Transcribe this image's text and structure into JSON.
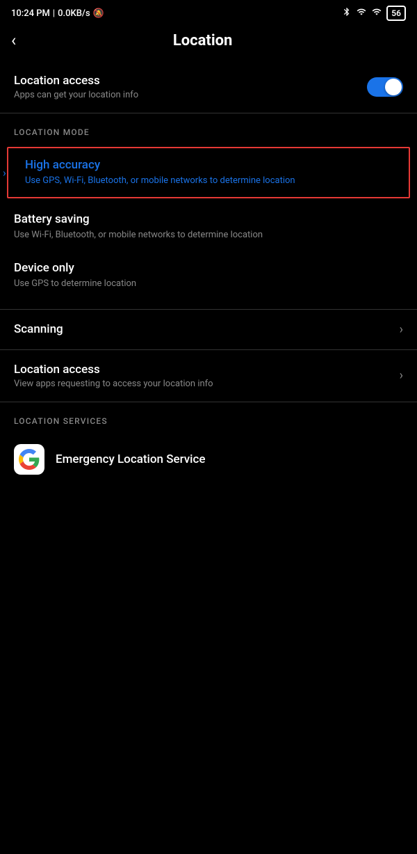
{
  "statusBar": {
    "time": "10:24 PM",
    "network": "0.0KB/s",
    "battery": "56"
  },
  "header": {
    "backLabel": "‹",
    "title": "Location"
  },
  "locationAccess": {
    "title": "Location access",
    "subtitle": "Apps can get your location info",
    "toggleOn": true
  },
  "locationMode": {
    "sectionLabel": "LOCATION MODE",
    "modes": [
      {
        "title": "High accuracy",
        "desc": "Use GPS, Wi-Fi, Bluetooth, or mobile networks to determine location",
        "highlighted": true,
        "showChevron": true
      },
      {
        "title": "Battery saving",
        "desc": "Use Wi-Fi, Bluetooth, or mobile networks to determine location",
        "highlighted": false,
        "showChevron": false
      },
      {
        "title": "Device only",
        "desc": "Use GPS to determine location",
        "highlighted": false,
        "showChevron": false
      }
    ]
  },
  "navItems": [
    {
      "title": "Scanning",
      "desc": "",
      "showChevron": true
    },
    {
      "title": "Location access",
      "desc": "View apps requesting to access your location info",
      "showChevron": true
    }
  ],
  "locationServices": {
    "sectionLabel": "LOCATION SERVICES",
    "items": [
      {
        "icon": "G",
        "title": "Emergency Location Service"
      }
    ]
  }
}
